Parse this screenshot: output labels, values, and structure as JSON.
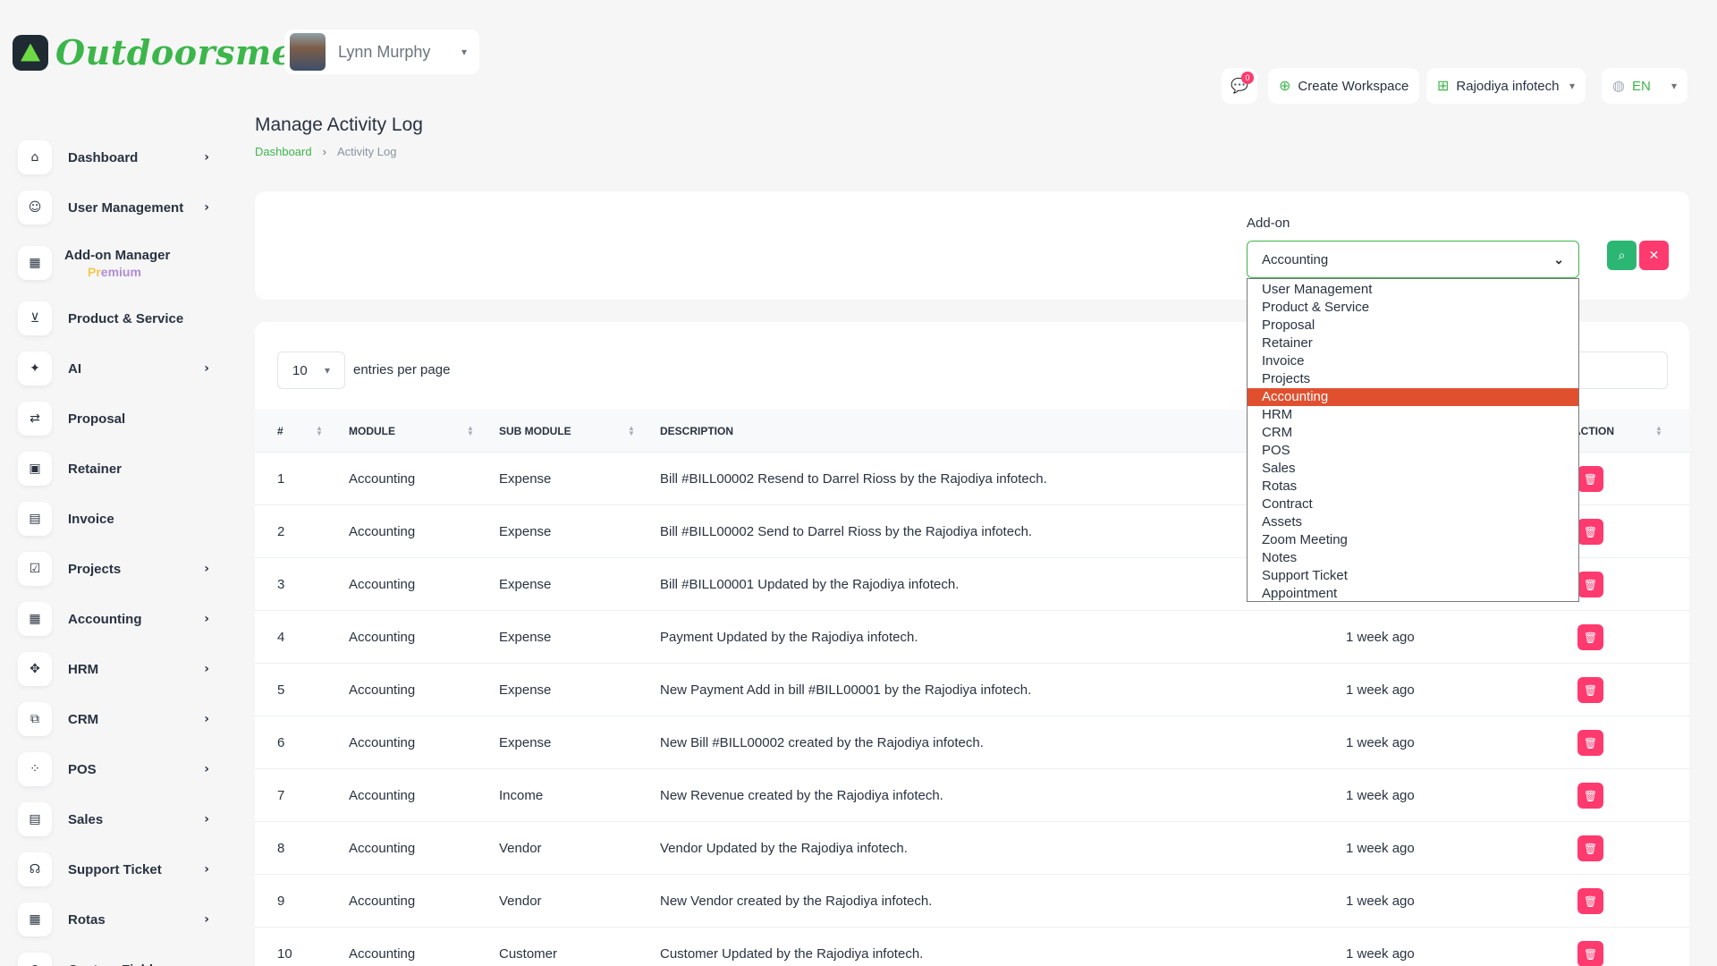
{
  "app": {
    "brand": "Outdoorsmen"
  },
  "user": {
    "name": "Lynn Murphy"
  },
  "topbar": {
    "notification_count": "0",
    "create_workspace": "Create Workspace",
    "workspace": "Rajodiya infotech",
    "language": "EN"
  },
  "sidebar": {
    "items": [
      {
        "label": "Dashboard",
        "icon": "home-icon",
        "chevron": true
      },
      {
        "label": "User Management",
        "icon": "users-icon",
        "chevron": true
      },
      {
        "label": "Add-on Manager",
        "icon": "apps-icon",
        "chevron": false,
        "sub_pre": "Pr",
        "sub_rest": "emium"
      },
      {
        "label": "Product & Service",
        "icon": "cart-icon",
        "chevron": false
      },
      {
        "label": "AI",
        "icon": "ai-icon",
        "chevron": true
      },
      {
        "label": "Proposal",
        "icon": "proposal-icon",
        "chevron": false
      },
      {
        "label": "Retainer",
        "icon": "retainer-icon",
        "chevron": false
      },
      {
        "label": "Invoice",
        "icon": "invoice-icon",
        "chevron": false
      },
      {
        "label": "Projects",
        "icon": "projects-icon",
        "chevron": true
      },
      {
        "label": "Accounting",
        "icon": "accounting-icon",
        "chevron": true
      },
      {
        "label": "HRM",
        "icon": "hrm-icon",
        "chevron": true
      },
      {
        "label": "CRM",
        "icon": "crm-icon",
        "chevron": true
      },
      {
        "label": "POS",
        "icon": "pos-icon",
        "chevron": true
      },
      {
        "label": "Sales",
        "icon": "sales-icon",
        "chevron": true
      },
      {
        "label": "Support Ticket",
        "icon": "headset-icon",
        "chevron": true
      },
      {
        "label": "Rotas",
        "icon": "rotas-icon",
        "chevron": true
      },
      {
        "label": "Custom Field",
        "icon": "plus-circle-icon",
        "chevron": false
      }
    ]
  },
  "page": {
    "title": "Manage Activity Log",
    "breadcrumb": {
      "home": "Dashboard",
      "current": "Activity Log"
    }
  },
  "filter": {
    "label": "Add-on",
    "selected": "Accounting",
    "options": [
      "User Management",
      "Product & Service",
      "Proposal",
      "Retainer",
      "Invoice",
      "Projects",
      "Accounting",
      "HRM",
      "CRM",
      "POS",
      "Sales",
      "Rotas",
      "Contract",
      "Assets",
      "Zoom Meeting",
      "Notes",
      "Support Ticket",
      "Appointment"
    ]
  },
  "table": {
    "per_page": "10",
    "per_page_label": "entries per page",
    "headers": {
      "num": "#",
      "module": "MODULE",
      "sub_module": "SUB MODULE",
      "description": "DESCRIPTION",
      "action": "ACTION"
    },
    "rows": [
      {
        "num": "1",
        "module": "Accounting",
        "sub_module": "Expense",
        "description": "Bill #BILL00002 Resend to Darrel Rioss by the Rajodiya infotech.",
        "time": ""
      },
      {
        "num": "2",
        "module": "Accounting",
        "sub_module": "Expense",
        "description": "Bill #BILL00002 Send to Darrel Rioss by the Rajodiya infotech.",
        "time": ""
      },
      {
        "num": "3",
        "module": "Accounting",
        "sub_module": "Expense",
        "description": "Bill #BILL00001 Updated by the Rajodiya infotech.",
        "time": ""
      },
      {
        "num": "4",
        "module": "Accounting",
        "sub_module": "Expense",
        "description": "Payment Updated by the Rajodiya infotech.",
        "time": "1 week ago"
      },
      {
        "num": "5",
        "module": "Accounting",
        "sub_module": "Expense",
        "description": "New Payment Add in bill #BILL00001 by the Rajodiya infotech.",
        "time": "1 week ago"
      },
      {
        "num": "6",
        "module": "Accounting",
        "sub_module": "Expense",
        "description": "New Bill #BILL00002 created by the Rajodiya infotech.",
        "time": "1 week ago"
      },
      {
        "num": "7",
        "module": "Accounting",
        "sub_module": "Income",
        "description": "New Revenue created by the Rajodiya infotech.",
        "time": "1 week ago"
      },
      {
        "num": "8",
        "module": "Accounting",
        "sub_module": "Vendor",
        "description": "Vendor Updated by the Rajodiya infotech.",
        "time": "1 week ago"
      },
      {
        "num": "9",
        "module": "Accounting",
        "sub_module": "Vendor",
        "description": "New Vendor created by the Rajodiya infotech.",
        "time": "1 week ago"
      },
      {
        "num": "10",
        "module": "Accounting",
        "sub_module": "Customer",
        "description": "Customer Updated by the Rajodiya infotech.",
        "time": "1 week ago"
      }
    ]
  }
}
